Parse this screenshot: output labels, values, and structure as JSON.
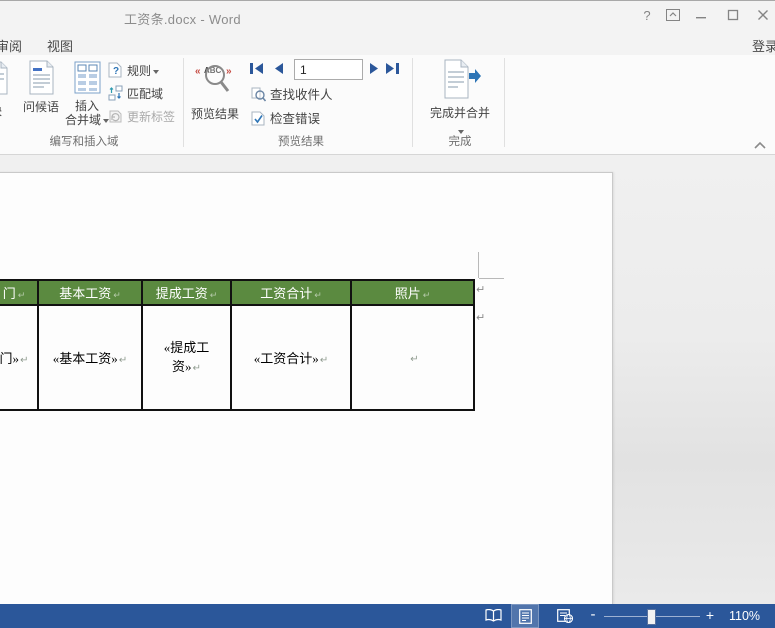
{
  "window": {
    "title": "工资条.docx - Word",
    "help_label": "?",
    "sign_in": "登录"
  },
  "tabs": {
    "review": "审阅",
    "view": "视图"
  },
  "ribbon": {
    "write_group": {
      "label": "编写和插入域",
      "address_block_cut": "块",
      "greeting_line": "问候语",
      "insert_merge_field_line1": "插入",
      "insert_merge_field_line2": "合并域",
      "rules": "规则",
      "match_fields": "匹配域",
      "update_labels": "更新标签"
    },
    "preview_group": {
      "label": "预览结果",
      "preview_results": "预览结果",
      "record_value": "1",
      "find_recipient": "查找收件人",
      "check_errors": "检查错误"
    },
    "finish_group": {
      "label": "完成",
      "finish_merge": "完成并合并"
    }
  },
  "document": {
    "table": {
      "headers": [
        "门",
        "基本工资",
        "提成工资",
        "工资合计",
        "照片"
      ],
      "row": [
        "门»",
        "«基本工资»",
        "«提成工资»",
        "«工资合计»",
        ""
      ]
    },
    "pilcrow": "↵"
  },
  "status_bar": {
    "zoom_minus": "-",
    "zoom_plus": "+",
    "zoom_percent": "110%"
  },
  "colors": {
    "accent_blue": "#2b579a",
    "header_green": "#5b8a40"
  }
}
